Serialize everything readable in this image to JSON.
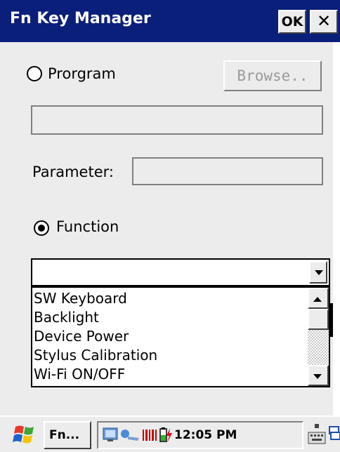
{
  "window": {
    "title": "Fn Key Manager",
    "ok_label": "OK",
    "close_label": "✕"
  },
  "program": {
    "radio_label": "Prorgram",
    "selected": false,
    "browse_label": "Browse..",
    "path_value": ""
  },
  "parameter": {
    "label": "Parameter:",
    "value": ""
  },
  "function": {
    "radio_label": "Function",
    "selected": true,
    "combo_value": "",
    "options": [
      "SW Keyboard",
      "Backlight",
      "Device Power",
      "Stylus Calibration",
      "Wi-Fi ON/OFF"
    ]
  },
  "taskbar": {
    "start_icon": "windows-flag-icon",
    "task_label": "Fn...",
    "tray_icons": [
      "network-icon",
      "connection-icon",
      "barcode-icon",
      "battery-charging-icon"
    ],
    "clock": "12:05 PM",
    "keyboard_icon": "keyboard-icon",
    "desktop_icon": "desktop-switch-icon"
  },
  "colors": {
    "titlebar": "#0a1f7a",
    "background": "#ececec"
  }
}
